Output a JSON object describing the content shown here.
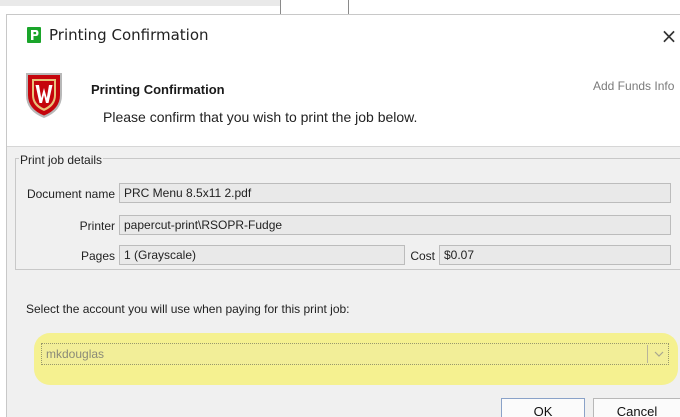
{
  "window": {
    "title": "Printing Confirmation",
    "close_glyph": "×",
    "icon": "papercut-p-icon",
    "accent": "#1aa52a"
  },
  "header": {
    "title": "Printing Confirmation",
    "subtitle": "Please confirm that you wish to print the job below.",
    "link": "Add Funds Info",
    "logo": "uw-crest-logo"
  },
  "details": {
    "legend": "Print job details",
    "document_name_label": "Document name",
    "document_name": "PRC Menu 8.5x11 2.pdf",
    "printer_label": "Printer",
    "printer": "papercut-print\\RSOPR-Fudge",
    "pages_label": "Pages",
    "pages": "1  (Grayscale)",
    "cost_label": "Cost",
    "cost": "$0.07"
  },
  "account": {
    "prompt": "Select the account you will use when paying for this print job:",
    "selected": "mkdouglas",
    "highlight_color": "#f4f08a"
  },
  "buttons": {
    "ok": "OK",
    "cancel": "Cancel"
  }
}
